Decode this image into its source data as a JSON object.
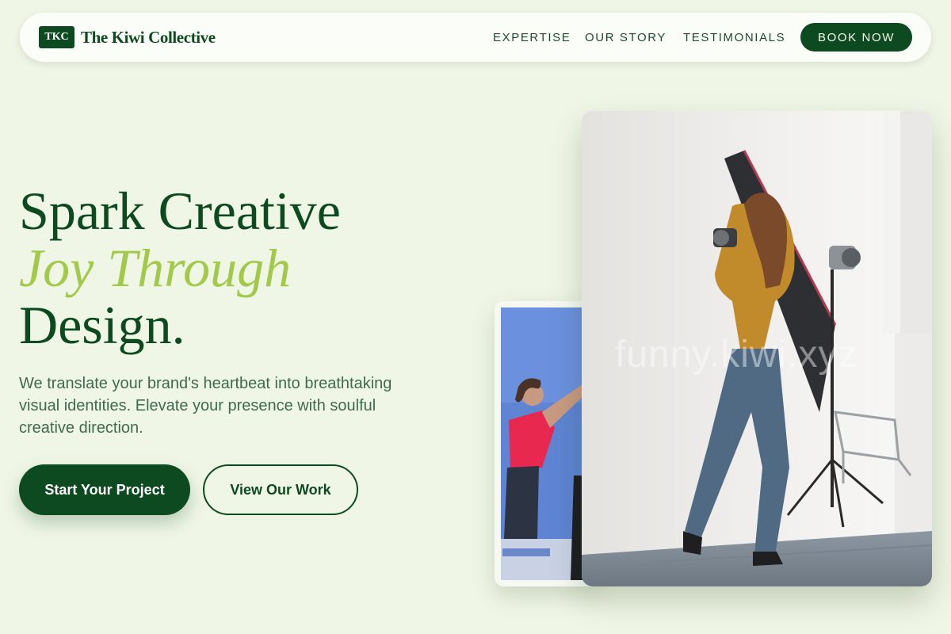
{
  "brand": {
    "badge": "TKC",
    "name": "The Kiwi Collective"
  },
  "nav": {
    "links": [
      "EXPERTISE",
      "OUR STORY",
      "TESTIMONIALS"
    ],
    "cta": "BOOK NOW"
  },
  "hero": {
    "headline_line1": "Spark Creative",
    "headline_accent": "Joy Through",
    "headline_line3": "Design.",
    "subtext": "We translate your brand's heartbeat into breathtaking visual identities. Elevate your presence with soulful creative direction.",
    "primary_cta": "Start Your Project",
    "secondary_cta": "View Our Work"
  },
  "images": {
    "small_alt": "Woman in red shirt posing in front of a blue backdrop",
    "large_alt": "Photographer in yellow sweater shooting in a studio with softbox lights",
    "watermark": "funny.kiwi.xyz"
  },
  "colors": {
    "background": "#f0f6e6",
    "primary": "#0d4a1f",
    "accent": "#a3c94a",
    "text_muted": "#3e6b4b"
  }
}
